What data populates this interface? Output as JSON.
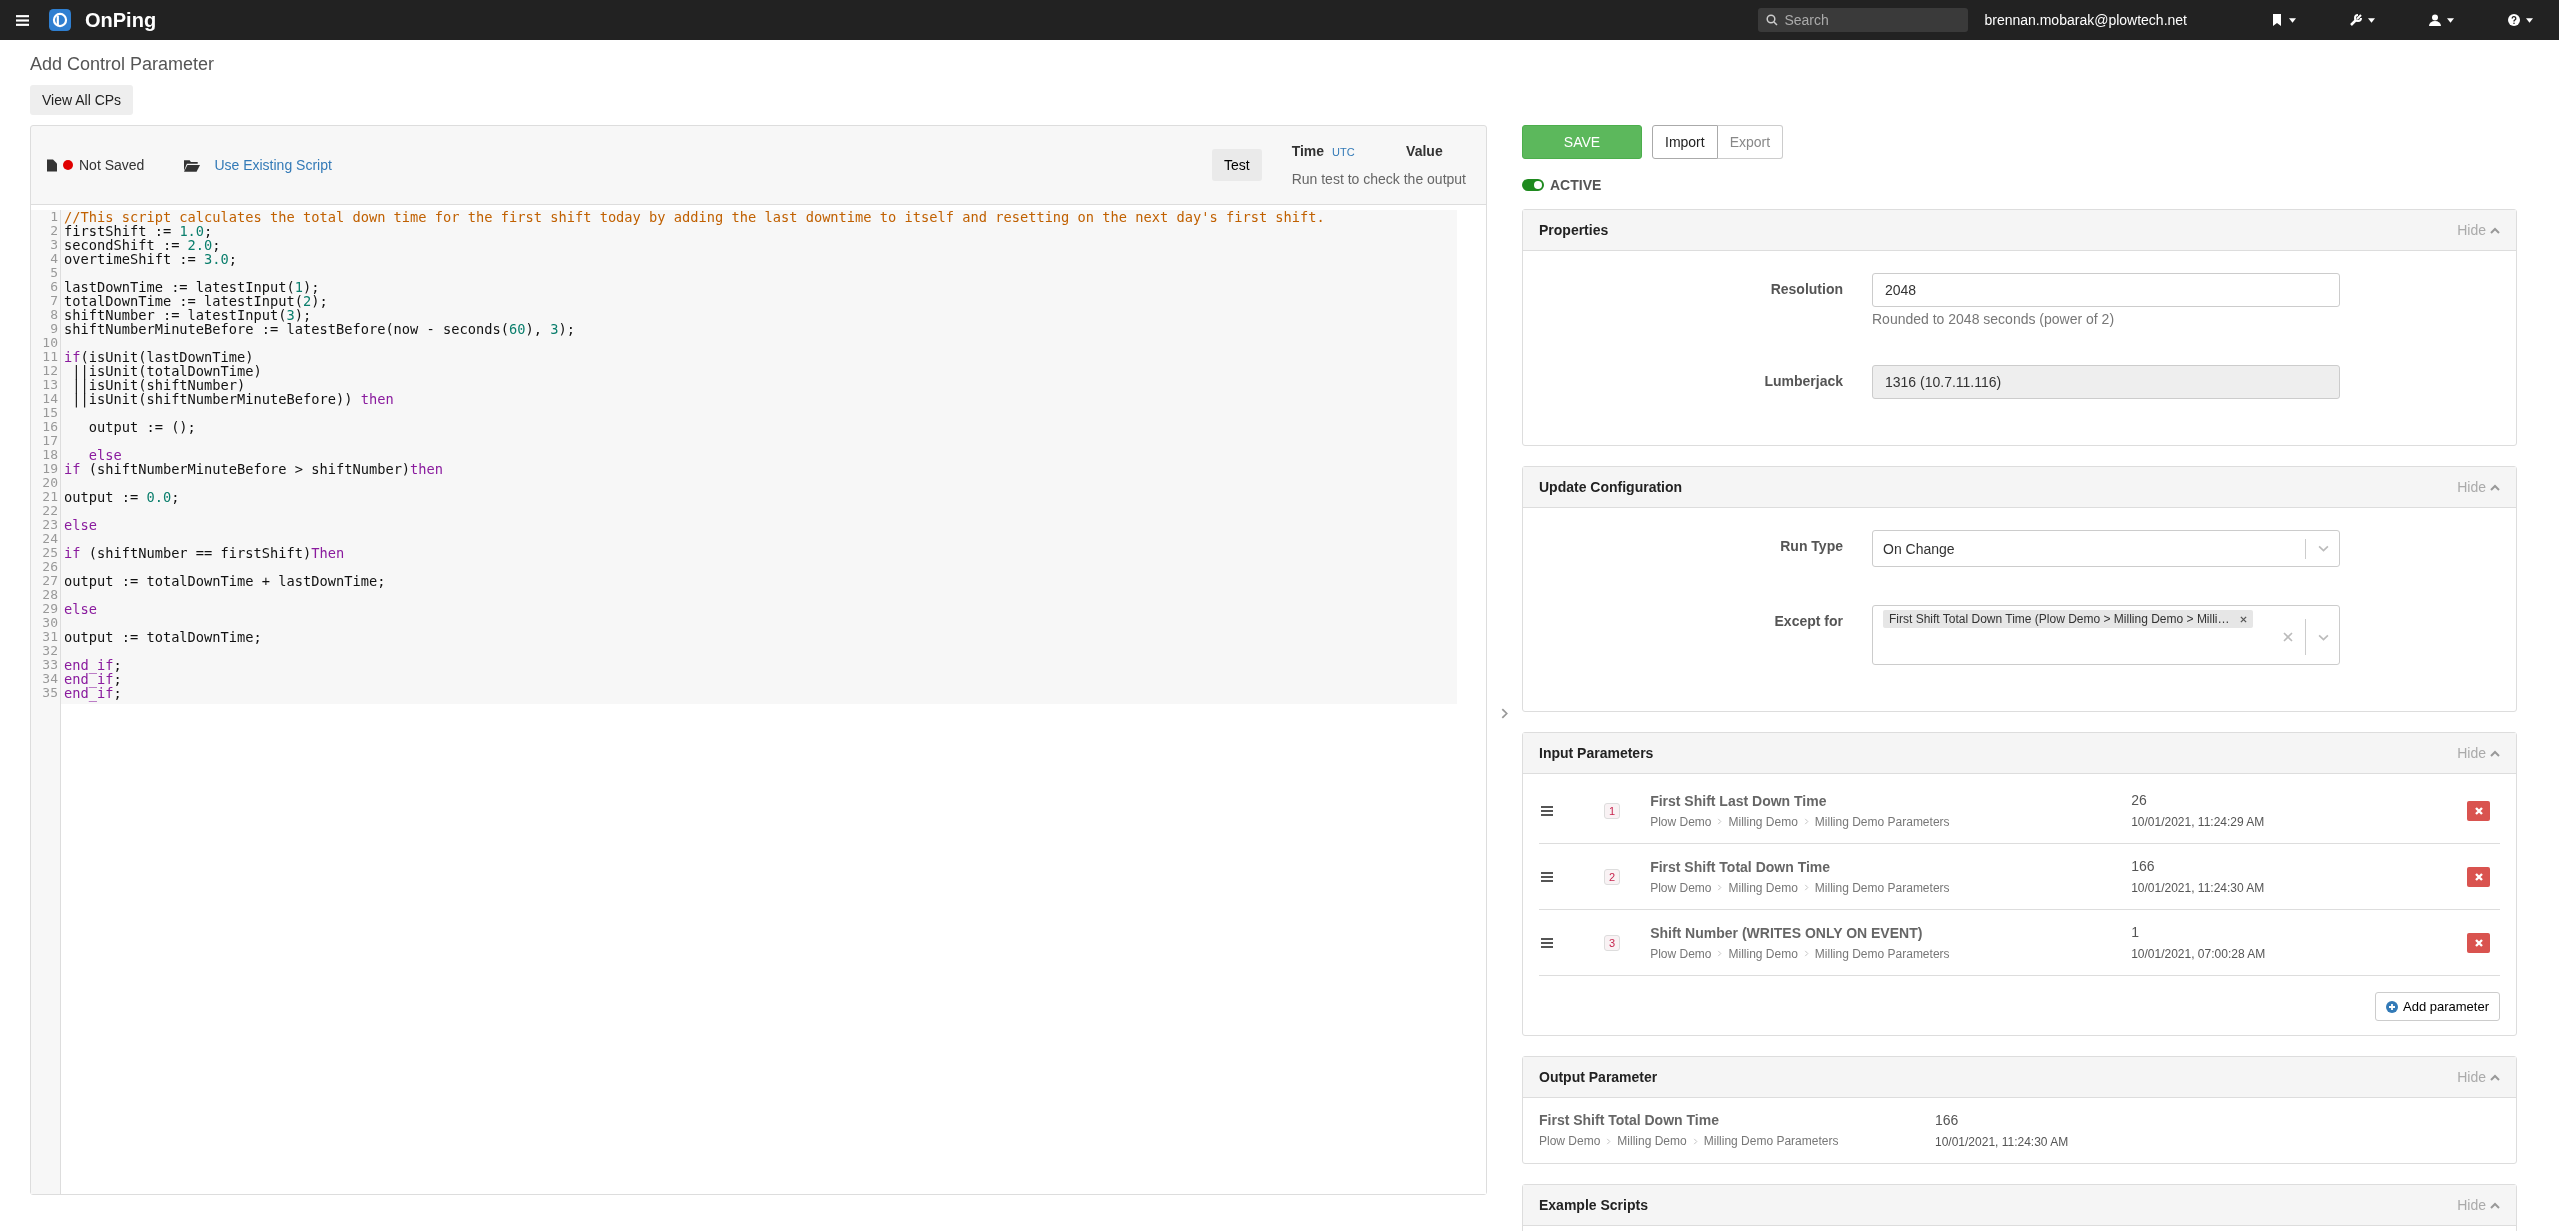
{
  "topbar": {
    "brand": "OnPing",
    "search": {
      "placeholder": "Search"
    },
    "user": "brennan.mobarak@plowtech.net"
  },
  "page": {
    "title": "Add Control Parameter",
    "back_button": "View All CPs"
  },
  "editor": {
    "status": "Not Saved",
    "saved": false,
    "script_link": "Use Existing Script",
    "test_button": "Test",
    "time_label": "Time",
    "timezone": "UTC",
    "value_label": "Value",
    "hint": "Run test to check the output",
    "lines": [
      {
        "n": "1",
        "tokens": [
          {
            "kind": "comment",
            "text": "//This script calculates the total down time for the first shift today by adding the last downtime to itself and resetting on the next day's first shift."
          }
        ]
      },
      {
        "n": "2",
        "tokens": [
          {
            "kind": "plain",
            "text": "firstShift := "
          },
          {
            "kind": "number",
            "text": "1.0"
          },
          {
            "kind": "plain",
            "text": ";"
          }
        ]
      },
      {
        "n": "3",
        "tokens": [
          {
            "kind": "plain",
            "text": "secondShift := "
          },
          {
            "kind": "number",
            "text": "2.0"
          },
          {
            "kind": "plain",
            "text": ";"
          }
        ]
      },
      {
        "n": "4",
        "tokens": [
          {
            "kind": "plain",
            "text": "overtimeShift := "
          },
          {
            "kind": "number",
            "text": "3.0"
          },
          {
            "kind": "plain",
            "text": ";"
          }
        ]
      },
      {
        "n": "5"
      },
      {
        "n": "6",
        "tokens": [
          {
            "kind": "plain",
            "text": "lastDownTime := latestInput("
          },
          {
            "kind": "number",
            "text": "1"
          },
          {
            "kind": "plain",
            "text": ");"
          }
        ]
      },
      {
        "n": "7",
        "tokens": [
          {
            "kind": "plain",
            "text": "totalDownTime := latestInput("
          },
          {
            "kind": "number",
            "text": "2"
          },
          {
            "kind": "plain",
            "text": ");"
          }
        ]
      },
      {
        "n": "8",
        "tokens": [
          {
            "kind": "plain",
            "text": "shiftNumber := latestInput("
          },
          {
            "kind": "number",
            "text": "3"
          },
          {
            "kind": "plain",
            "text": ");"
          }
        ]
      },
      {
        "n": "9",
        "tokens": [
          {
            "kind": "plain",
            "text": "shiftNumberMinuteBefore := latestBefore(now - seconds("
          },
          {
            "kind": "number",
            "text": "60"
          },
          {
            "kind": "plain",
            "text": "), "
          },
          {
            "kind": "number",
            "text": "3"
          },
          {
            "kind": "plain",
            "text": ");"
          }
        ]
      },
      {
        "n": "10"
      },
      {
        "n": "11",
        "tokens": [
          {
            "kind": "keyword",
            "text": "if"
          },
          {
            "kind": "plain",
            "text": "(isUnit(lastDownTime)"
          }
        ]
      },
      {
        "n": "12",
        "tokens": [
          {
            "kind": "plain",
            "text": " ||isUnit(totalDownTime)"
          }
        ]
      },
      {
        "n": "13",
        "tokens": [
          {
            "kind": "plain",
            "text": " ||isUnit(shiftNumber)"
          }
        ]
      },
      {
        "n": "14",
        "tokens": [
          {
            "kind": "plain",
            "text": " ||isUnit(shiftNumberMinuteBefore)) "
          },
          {
            "kind": "keyword",
            "text": "then"
          }
        ]
      },
      {
        "n": "15"
      },
      {
        "n": "16",
        "tokens": [
          {
            "kind": "plain",
            "text": "   output := ();"
          }
        ]
      },
      {
        "n": "17"
      },
      {
        "n": "18",
        "tokens": [
          {
            "kind": "keyword",
            "text": "   else"
          }
        ]
      },
      {
        "n": "19",
        "tokens": [
          {
            "kind": "keyword",
            "text": "if"
          },
          {
            "kind": "plain",
            "text": " (shiftNumberMinuteBefore > shiftNumber)"
          },
          {
            "kind": "keyword",
            "text": "then"
          }
        ]
      },
      {
        "n": "20"
      },
      {
        "n": "21",
        "tokens": [
          {
            "kind": "plain",
            "text": "output := "
          },
          {
            "kind": "number",
            "text": "0.0"
          },
          {
            "kind": "plain",
            "text": ";"
          }
        ]
      },
      {
        "n": "22"
      },
      {
        "n": "23",
        "tokens": [
          {
            "kind": "keyword",
            "text": "else"
          }
        ]
      },
      {
        "n": "24"
      },
      {
        "n": "25",
        "tokens": [
          {
            "kind": "keyword",
            "text": "if"
          },
          {
            "kind": "plain",
            "text": " (shiftNumber == firstShift)"
          },
          {
            "kind": "keyword",
            "text": "Then"
          }
        ]
      },
      {
        "n": "26"
      },
      {
        "n": "27",
        "tokens": [
          {
            "kind": "plain",
            "text": "output := totalDownTime + lastDownTime;"
          }
        ]
      },
      {
        "n": "28"
      },
      {
        "n": "29",
        "tokens": [
          {
            "kind": "keyword",
            "text": "else"
          }
        ]
      },
      {
        "n": "30"
      },
      {
        "n": "31",
        "tokens": [
          {
            "kind": "plain",
            "text": "output := totalDownTime;"
          }
        ]
      },
      {
        "n": "32"
      },
      {
        "n": "33",
        "tokens": [
          {
            "kind": "keyword",
            "text": "end_if"
          },
          {
            "kind": "plain",
            "text": ";"
          }
        ]
      },
      {
        "n": "34",
        "tokens": [
          {
            "kind": "keyword",
            "text": "end_if"
          },
          {
            "kind": "plain",
            "text": ";"
          }
        ]
      },
      {
        "n": "35",
        "tokens": [
          {
            "kind": "keyword",
            "text": "end_if"
          },
          {
            "kind": "plain",
            "text": ";"
          }
        ]
      }
    ]
  },
  "actions": {
    "save": "SAVE",
    "tabs": [
      {
        "label": "Import",
        "selected": true
      },
      {
        "label": "Export",
        "selected": false
      }
    ],
    "active_toggle": {
      "label": "ACTIVE",
      "on": true
    }
  },
  "properties": {
    "title": "Properties",
    "hide": "Hide",
    "resolution": {
      "label": "Resolution",
      "value": "2048",
      "help": "Rounded to 2048 seconds (power of 2)"
    },
    "lumberjack": {
      "label": "Lumberjack",
      "value": "1316 (10.7.11.116)"
    }
  },
  "update_configuration": {
    "title": "Update Configuration",
    "hide": "Hide",
    "run_type": {
      "label": "Run Type",
      "value": "On Change"
    },
    "except_for": {
      "label": "Except for",
      "tags": [
        "First Shift Total Down Time (Plow Demo > Milling Demo > Milli…"
      ]
    }
  },
  "input_parameters": {
    "title": "Input Parameters",
    "hide": "Hide",
    "add_button": "Add parameter",
    "items": [
      {
        "index": "1",
        "name": "First Shift Last Down Time",
        "path": [
          "Plow Demo",
          "Milling Demo",
          "Milling Demo Parameters"
        ],
        "value": "26",
        "time": "10/01/2021, 11:24:29 AM"
      },
      {
        "index": "2",
        "name": "First Shift Total Down Time",
        "path": [
          "Plow Demo",
          "Milling Demo",
          "Milling Demo Parameters"
        ],
        "value": "166",
        "time": "10/01/2021, 11:24:30 AM"
      },
      {
        "index": "3",
        "name": "Shift Number (WRITES ONLY ON EVENT)",
        "path": [
          "Plow Demo",
          "Milling Demo",
          "Milling Demo Parameters"
        ],
        "value": "1",
        "time": "10/01/2021, 07:00:28 AM"
      }
    ]
  },
  "output_parameter": {
    "title": "Output Parameter",
    "hide": "Hide",
    "name": "First Shift Total Down Time",
    "path": [
      "Plow Demo",
      "Milling Demo",
      "Milling Demo Parameters"
    ],
    "value": "166",
    "time": "10/01/2021, 11:24:30 AM"
  },
  "example_scripts": {
    "title": "Example Scripts",
    "hide": "Hide"
  }
}
